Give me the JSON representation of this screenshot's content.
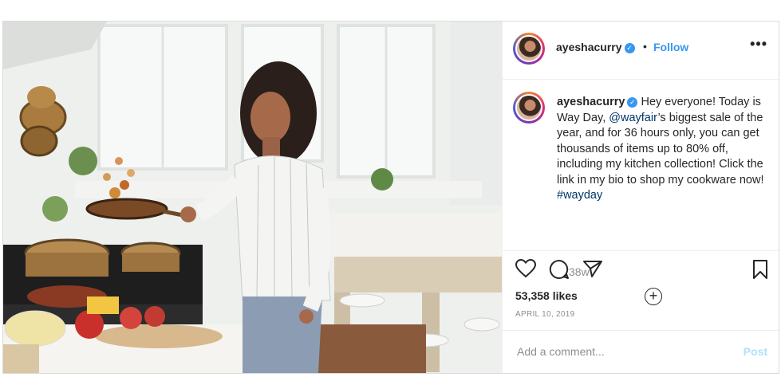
{
  "post": {
    "username": "ayeshacurry",
    "verified_glyph": "✓",
    "dot": "•",
    "follow_label": "Follow",
    "more_label": "•••",
    "caption_username": "ayeshacurry",
    "caption_part1": " Hey everyone! Today is Way Day, ",
    "caption_mention": "@wayfair",
    "caption_part2": "’s biggest sale of the year, and for 36 hours only, you can get thousands of items up to 80% off, including my kitchen collection! Click the link in my bio to shop my cookware now! ",
    "caption_hashtag": "#wayday",
    "time_ago": "38w",
    "load_more_glyph": "+",
    "likes": "53,358 likes",
    "date": "APRIL 10, 2019",
    "comment_placeholder": "Add a comment...",
    "post_label": "Post"
  },
  "icons": {
    "like": "heart-icon",
    "comment": "comment-icon",
    "share": "share-icon",
    "save": "bookmark-icon",
    "more": "more-options-icon",
    "verified": "verified-badge-icon",
    "load_more": "load-more-comments-icon"
  },
  "colors": {
    "accent": "#3897f0",
    "mention": "#003569",
    "muted": "#8e8e8e",
    "post_disabled": "#b2dffc",
    "text": "#262626"
  }
}
